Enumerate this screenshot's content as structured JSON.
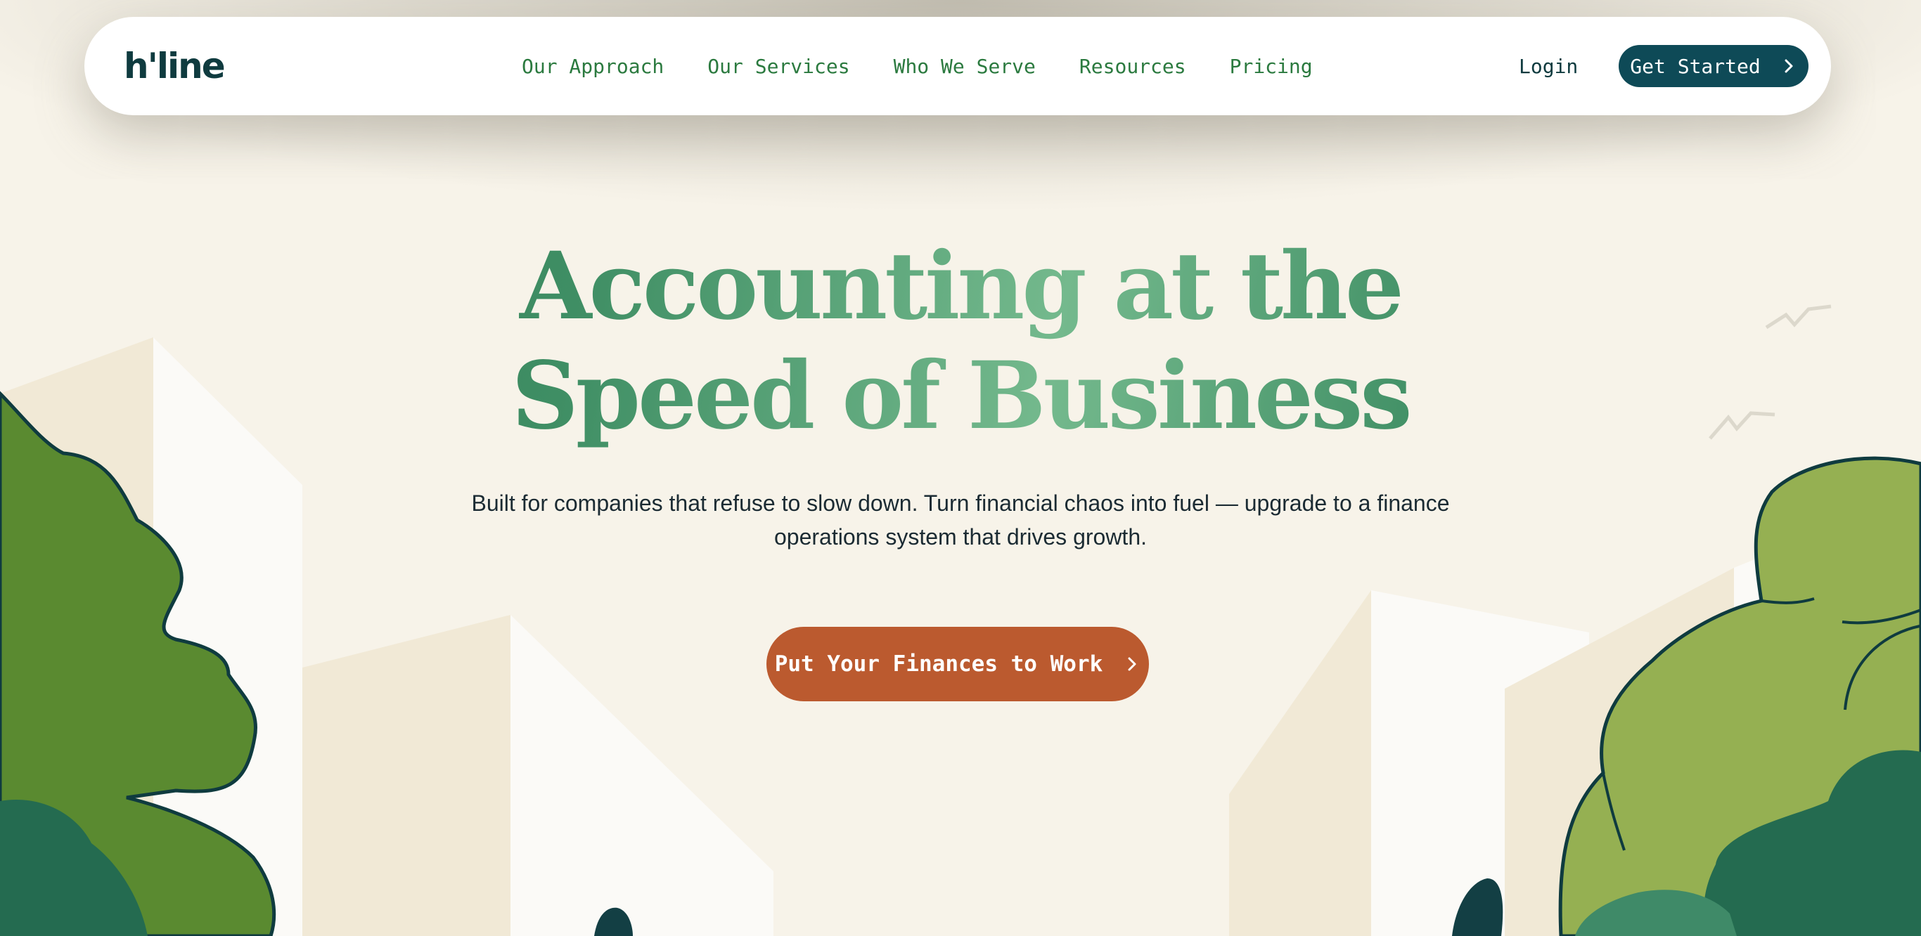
{
  "brand": {
    "logo_text": "h'line"
  },
  "nav": {
    "links": [
      {
        "label": "Our Approach"
      },
      {
        "label": "Our Services"
      },
      {
        "label": "Who We Serve"
      },
      {
        "label": "Resources"
      },
      {
        "label": "Pricing"
      }
    ],
    "login_label": "Login",
    "cta_label": "Get Started"
  },
  "hero": {
    "title_line1": "Accounting at the",
    "title_line2": "Speed of Business",
    "subtitle": "Built for companies that refuse to slow down. Turn financial chaos into fuel — upgrade to a finance operations system that drives growth.",
    "cta_label": "Put Your Finances to Work"
  },
  "colors": {
    "background": "#f7f3e9",
    "nav_link": "#2b7a3f",
    "dark_teal": "#0e4a57",
    "cta_orange": "#bb5a2f",
    "title_green": "#3f8e64",
    "tree_green": "#5a8a30",
    "tree_light": "#95b052"
  },
  "icons": {
    "chevron": "chevron-right-icon",
    "birds": "bird-icon"
  }
}
